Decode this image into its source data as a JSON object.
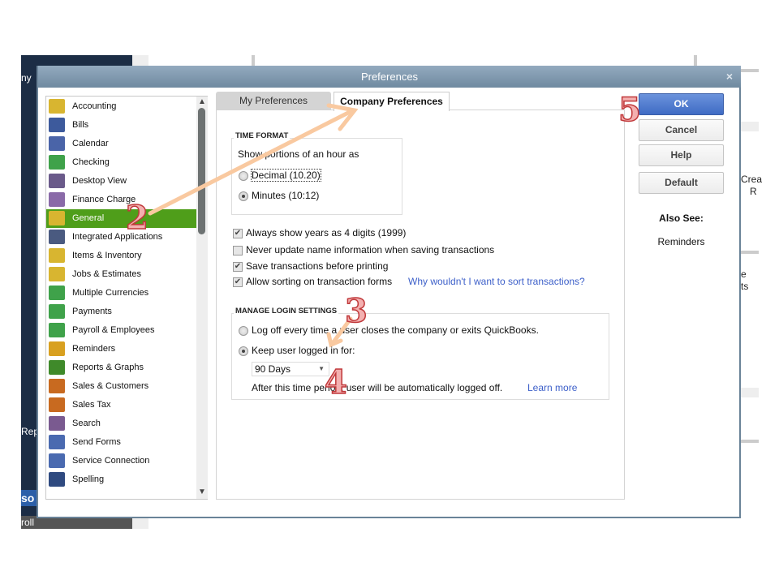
{
  "background": {
    "frag_left_top": "ny",
    "frag_left_mid": "Repo",
    "frag_left_bar": "so",
    "frag_left_bottom": "roll",
    "frag_right_1": "Crea",
    "frag_right_2": "R",
    "frag_right_3": "e",
    "frag_right_4": "ts"
  },
  "dialog": {
    "title": "Preferences",
    "close": "×"
  },
  "sidebar": {
    "items": [
      {
        "label": "Accounting",
        "color": "#d8b530"
      },
      {
        "label": "Bills",
        "color": "#3d5a9c"
      },
      {
        "label": "Calendar",
        "color": "#4a64a8"
      },
      {
        "label": "Checking",
        "color": "#3fa24a"
      },
      {
        "label": "Desktop View",
        "color": "#6a5a8a"
      },
      {
        "label": "Finance Charge",
        "color": "#8a6aa8"
      },
      {
        "label": "General",
        "color": "#d8b530",
        "selected": true
      },
      {
        "label": "Integrated Applications",
        "color": "#4a5a80"
      },
      {
        "label": "Items & Inventory",
        "color": "#d8b530"
      },
      {
        "label": "Jobs & Estimates",
        "color": "#d8b530"
      },
      {
        "label": "Multiple Currencies",
        "color": "#3fa24a"
      },
      {
        "label": "Payments",
        "color": "#3fa24a"
      },
      {
        "label": "Payroll & Employees",
        "color": "#3fa24a"
      },
      {
        "label": "Reminders",
        "color": "#d8a020"
      },
      {
        "label": "Reports & Graphs",
        "color": "#3f8a2a"
      },
      {
        "label": "Sales & Customers",
        "color": "#c86a20"
      },
      {
        "label": "Sales Tax",
        "color": "#c86a20"
      },
      {
        "label": "Search",
        "color": "#7a5a90"
      },
      {
        "label": "Send Forms",
        "color": "#4a6ab0"
      },
      {
        "label": "Service Connection",
        "color": "#4a6ab0"
      },
      {
        "label": "Spelling",
        "color": "#2f4a80"
      }
    ]
  },
  "tabs": {
    "my": "My Preferences",
    "company": "Company Preferences",
    "active": "company"
  },
  "time_format": {
    "title": "TIME FORMAT",
    "prompt": "Show portions of an hour as",
    "decimal": "Decimal (10.20)",
    "minutes": "Minutes (10:12)",
    "selected": "minutes"
  },
  "options": [
    {
      "label": "Always show years as 4 digits (1999)",
      "checked": true
    },
    {
      "label": "Never update name information when saving transactions",
      "checked": false
    },
    {
      "label": "Save transactions before printing",
      "checked": true
    },
    {
      "label": "Allow sorting on transaction forms",
      "checked": true
    }
  ],
  "sort_link": "Why wouldn't I want to sort transactions?",
  "login": {
    "title": "MANAGE LOGIN SETTINGS",
    "logoff": "Log off every time a user closes the company or exits QuickBooks.",
    "keep": "Keep user logged in for:",
    "selected": "keep",
    "duration": "90 Days",
    "note": "After this time period, user will be automatically logged off.",
    "learn_more": "Learn more"
  },
  "buttons": {
    "ok": "OK",
    "cancel": "Cancel",
    "help": "Help",
    "default": "Default"
  },
  "also_see": {
    "title": "Also See:",
    "link": "Reminders"
  },
  "annotations": {
    "n2": "2",
    "n3": "3",
    "n4": "4",
    "n5": "5",
    "arrow_color": "#f9c9a0"
  },
  "check_mark": "✔"
}
